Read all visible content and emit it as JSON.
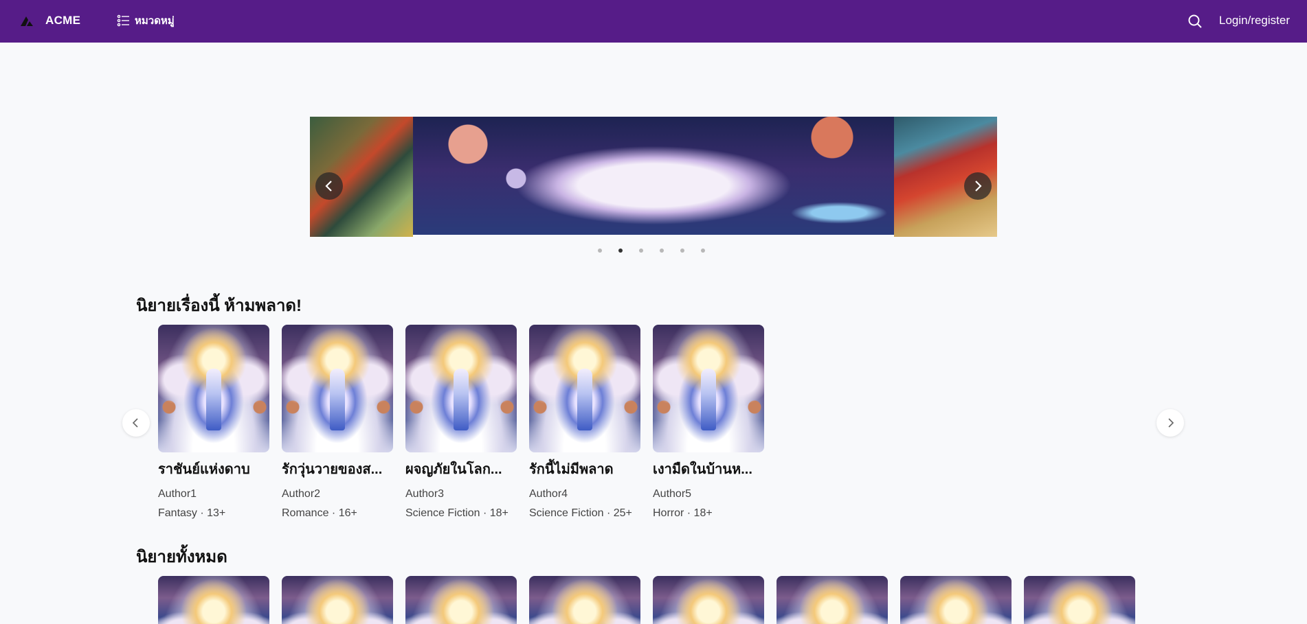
{
  "header": {
    "brand": "ACME",
    "categories_label": "หมวดหมู่",
    "login_label": "Login/register",
    "colors": {
      "bar": "#561c88",
      "text": "#ffffff"
    }
  },
  "banner": {
    "dots_count": 6,
    "active_dot": 1
  },
  "featured": {
    "title": "นิยายเรื่องนี้ ห้ามพลาด!",
    "items": [
      {
        "title": "ราชันย์แห่งดาบ",
        "author": "Author1",
        "meta": "Fantasy · 13+"
      },
      {
        "title": "รักวุ่นวายของส...",
        "author": "Author2",
        "meta": "Romance · 16+"
      },
      {
        "title": "ผจญภัยในโลก...",
        "author": "Author3",
        "meta": "Science Fiction · 18+"
      },
      {
        "title": "รักนี้ไม่มีพลาด",
        "author": "Author4",
        "meta": "Science Fiction · 25+"
      },
      {
        "title": "เงามืดในบ้านห...",
        "author": "Author5",
        "meta": "Horror · 18+"
      }
    ]
  },
  "all_novels": {
    "title": "นิยายทั้งหมด",
    "count_visible": 8
  },
  "icons": {
    "logo": "acme-logo-icon",
    "categories": "list-icon",
    "search": "search-icon",
    "prev": "chevron-left-icon",
    "next": "chevron-right-icon"
  }
}
